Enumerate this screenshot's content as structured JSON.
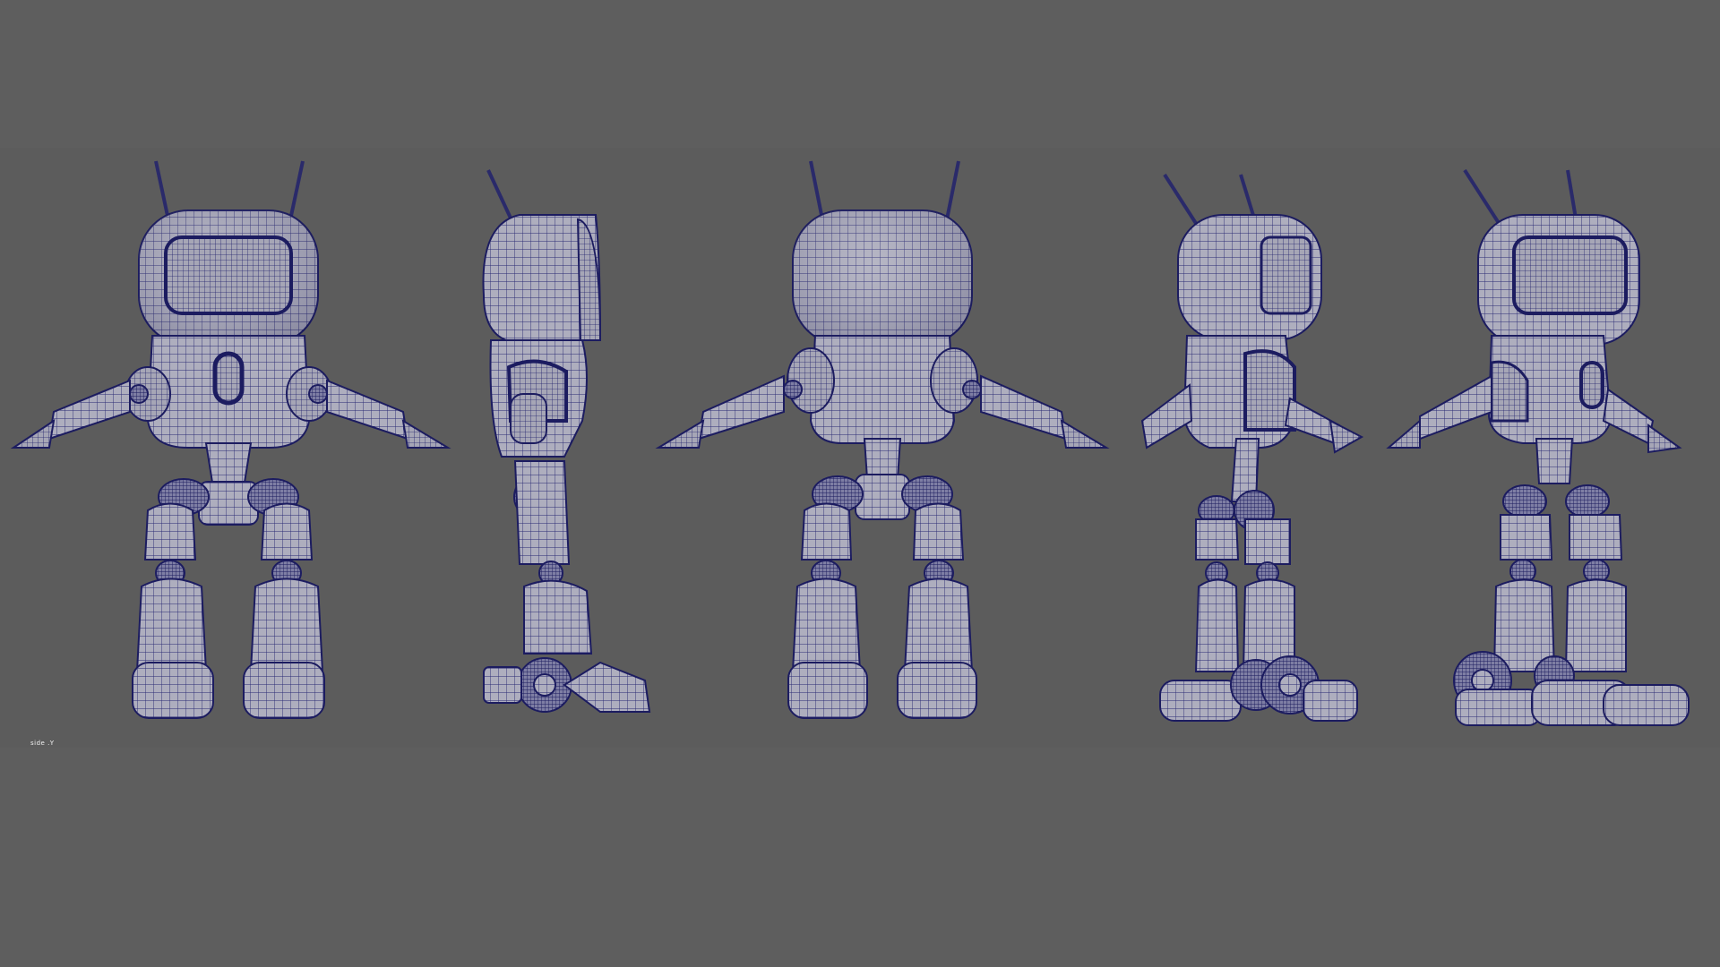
{
  "scene": {
    "background_color": "#5e5e5e",
    "mesh_fill_color": "#a9a9b8",
    "wire_color": "#23236e",
    "wire_dark_color": "#10104a",
    "views": [
      {
        "name": "front",
        "subject": "robot"
      },
      {
        "name": "side",
        "subject": "robot"
      },
      {
        "name": "back",
        "subject": "robot"
      },
      {
        "name": "three-quarter-back",
        "subject": "robot"
      },
      {
        "name": "three-quarter-front",
        "subject": "robot"
      }
    ]
  },
  "viewport": {
    "corner_label": "side .Y"
  }
}
